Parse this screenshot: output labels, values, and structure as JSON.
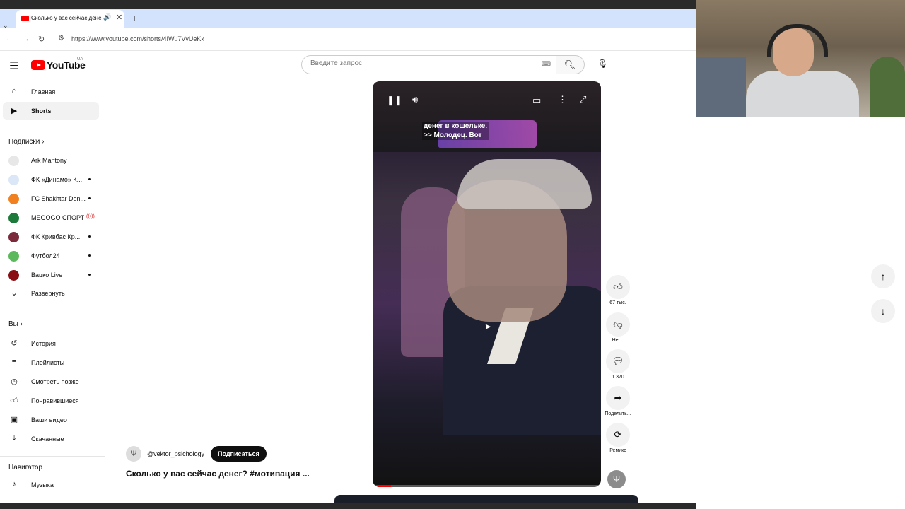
{
  "browser": {
    "tab_title": "Сколько у вас сейчас денег? #мотивация",
    "tab_close": "✕",
    "new_tab": "+",
    "url": "https://www.youtube.com/shorts/4IWu7VvUeKk"
  },
  "header": {
    "logo_text": "YouTube",
    "region": "UA",
    "search_placeholder": "Введите запрос"
  },
  "sidebar": {
    "main": [
      {
        "label": "Главная",
        "icon": "home-icon"
      },
      {
        "label": "Shorts",
        "icon": "shorts-icon",
        "active": true
      }
    ],
    "subscriptions_title": "Подписки",
    "subscriptions": [
      {
        "label": "Ark Mantony",
        "dot": false
      },
      {
        "label": "ФК «Динамо» К...",
        "dot": true
      },
      {
        "label": "FC Shakhtar Don...",
        "dot": true
      },
      {
        "label": "MEGOGO СПОРТ",
        "live": true
      },
      {
        "label": "ФК Кривбас Кр...",
        "dot": true
      },
      {
        "label": "Футбол24",
        "dot": true
      },
      {
        "label": "Вацко Live",
        "dot": true
      }
    ],
    "expand_label": "Развернуть",
    "you_title": "Вы",
    "you_items": [
      {
        "label": "История",
        "icon": "history-icon"
      },
      {
        "label": "Плейлисты",
        "icon": "playlists-icon"
      },
      {
        "label": "Смотреть позже",
        "icon": "watch-later-icon"
      },
      {
        "label": "Понравившиеся",
        "icon": "liked-icon"
      },
      {
        "label": "Ваши видео",
        "icon": "your-videos-icon"
      },
      {
        "label": "Скачанные",
        "icon": "downloads-icon"
      }
    ],
    "navigator_title": "Навигатор",
    "navigator_items": [
      {
        "label": "Музыка",
        "icon": "music-icon"
      }
    ]
  },
  "short": {
    "caption_line1": "денег в кошельке.",
    "caption_line2": ">> Молодец. Вот",
    "channel_handle": "@vektor_psichology",
    "subscribe_label": "Подписаться",
    "title": "Сколько у вас сейчас денег? #мотивация ...",
    "progress": 0.08
  },
  "actions": {
    "like_count": "67 тыс.",
    "dislike_label": "Не ...",
    "comments_count": "1 370",
    "share_label": "Поделить...",
    "remix_label": "Ремикс"
  },
  "colors": {
    "brand": "#ff0000",
    "tabbar": "#d3e3fd"
  }
}
